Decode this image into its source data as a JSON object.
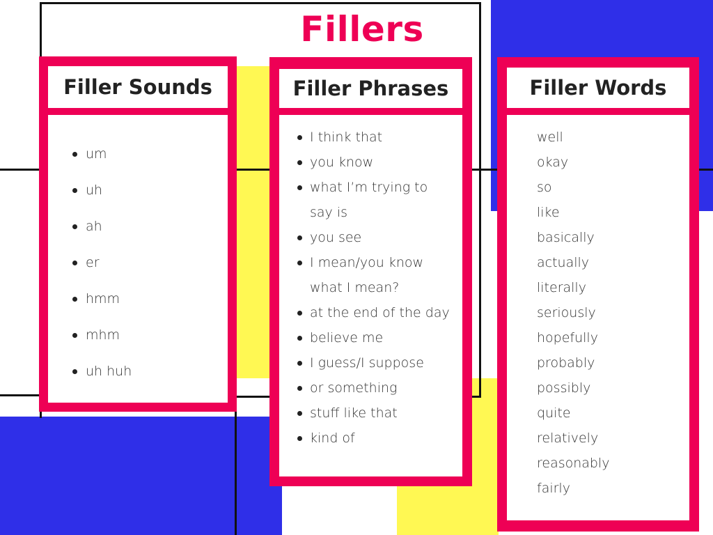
{
  "title": "Fillers",
  "colors": {
    "accent": "#EE0055",
    "blue": "#2F2FE8",
    "yellow": "#FFF853",
    "text": "#222222"
  },
  "cards": [
    {
      "heading": "Filler Sounds",
      "bulleted": true,
      "items": [
        "um",
        "uh",
        "ah",
        "er",
        "hmm",
        "mhm",
        "uh huh"
      ]
    },
    {
      "heading": "Filler Phrases",
      "bulleted": true,
      "items": [
        "I think that",
        "you know",
        "what I’m trying to say is",
        "you see",
        "I mean/you know what I mean?",
        "at the end of the day",
        "believe me",
        "I guess/I suppose",
        "or something",
        "stuff like that",
        "kind of"
      ]
    },
    {
      "heading": "Filler Words",
      "bulleted": false,
      "items": [
        "well",
        "okay",
        "so",
        "like",
        "basically",
        "actually",
        "literally",
        "seriously",
        "hopefully",
        "probably",
        "possibly",
        "quite",
        "relatively",
        "reasonably",
        "fairly"
      ]
    }
  ]
}
